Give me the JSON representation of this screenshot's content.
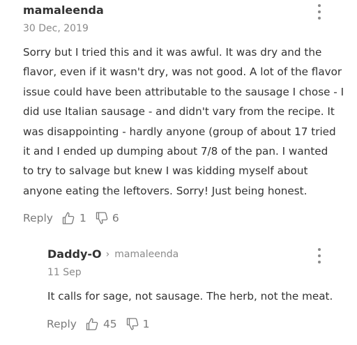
{
  "comments": [
    {
      "username": "mamaleenda",
      "date": "30 Dec, 2019",
      "lines": [
        "Sorry but I tried this and it was awful. It was dry and the",
        "flavor, even if it wasn't dry, was not good. A lot of the flavor",
        "issue could have been attributable to the sausage I chose - I",
        "did use Italian sausage - and didn't vary from the recipe. It",
        "was disappointing - hardly anyone (group of about 17 tried",
        "it and I ended up dumping about 7/8 of the pan. I wanted",
        "to try to salvage but knew I was kidding myself about",
        "anyone eating the leftovers. Sorry! Just being honest."
      ],
      "reply_label": "Reply",
      "upvotes": "1",
      "downvotes": "6"
    }
  ],
  "reply": {
    "username": "Daddy-O",
    "reply_to": "mamaleenda",
    "date": "11 Sep",
    "text": "It calls for sage, not sausage. The herb, not the meat.",
    "reply_label": "Reply",
    "upvotes": "45",
    "downvotes": "1"
  },
  "icons": {
    "more": "more-vertical-icon",
    "thumbs_up": "thumbs-up-icon",
    "thumbs_down": "thumbs-down-icon",
    "chevron": "chevron-right-icon"
  },
  "colors": {
    "text": "#333333",
    "muted": "#8a8a8a",
    "action": "#7a7a7a"
  }
}
